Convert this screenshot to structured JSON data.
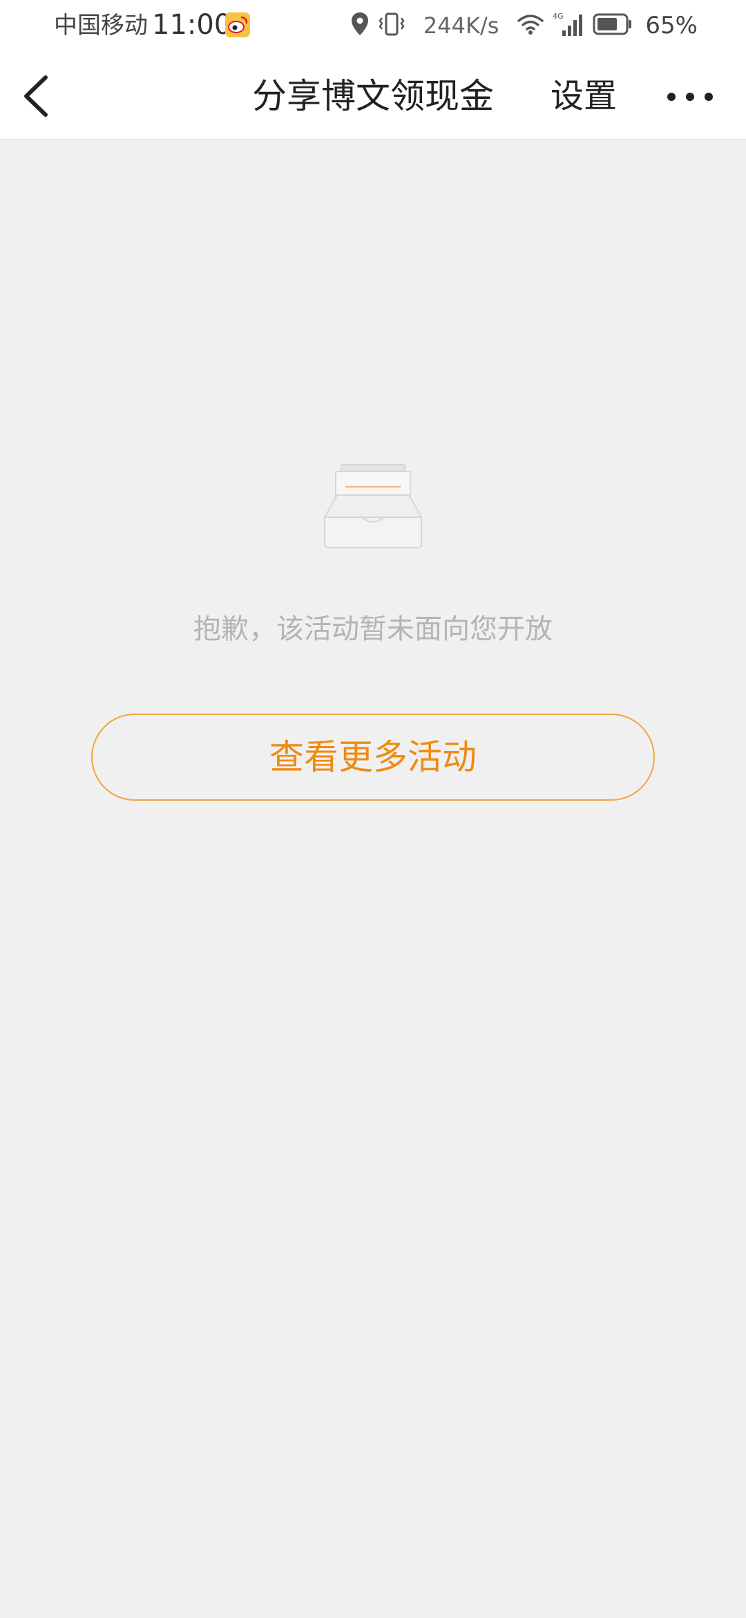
{
  "status_bar": {
    "carrier": "中国移动",
    "time": "11:00",
    "network_speed": "244K/s",
    "network_type": "4G",
    "battery_percent": "65%",
    "icons": [
      "weibo-icon",
      "location-icon",
      "vibrate-icon",
      "wifi-icon",
      "signal-icon",
      "battery-icon"
    ]
  },
  "header": {
    "title": "分享博文领现金",
    "settings_label": "设置",
    "icons": [
      "back-arrow-icon",
      "more-dots-icon"
    ]
  },
  "main": {
    "empty_message": "抱歉，该活动暂未面向您开放",
    "more_button_label": "查看更多活动",
    "illustration_icon": "empty-inbox-icon"
  },
  "colors": {
    "accent": "#ef8b12",
    "button_border": "#f0a53d",
    "background": "#f0f0f0",
    "muted_text": "#b4b4b4"
  }
}
